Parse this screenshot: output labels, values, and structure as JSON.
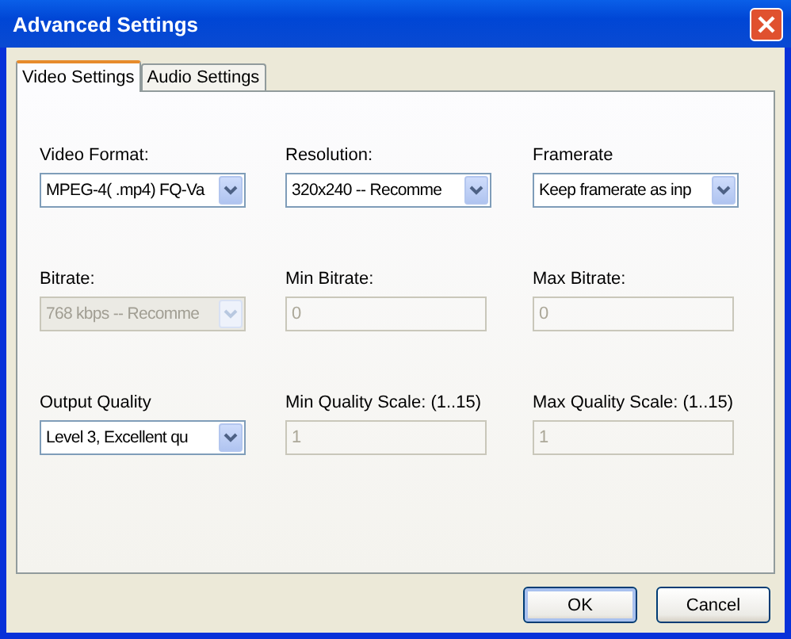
{
  "window": {
    "title": "Advanced Settings"
  },
  "tabs": [
    {
      "label": "Video Settings",
      "selected": true
    },
    {
      "label": "Audio Settings",
      "selected": false
    }
  ],
  "fields": [
    {
      "label": "Video Format:",
      "kind": "select",
      "value": "MPEG-4( .mp4) FQ-Va",
      "disabled": false
    },
    {
      "label": "Resolution:",
      "kind": "select",
      "value": "320x240 -- Recomme",
      "disabled": false
    },
    {
      "label": "Framerate",
      "kind": "select",
      "value": "Keep framerate as inp",
      "disabled": false
    },
    {
      "label": "Bitrate:",
      "kind": "select",
      "value": "768 kbps -- Recomme",
      "disabled": true
    },
    {
      "label": "Min Bitrate:",
      "kind": "text",
      "value": "0",
      "disabled": true
    },
    {
      "label": "Max Bitrate:",
      "kind": "text",
      "value": "0",
      "disabled": true
    },
    {
      "label": "Output Quality",
      "kind": "select",
      "value": "Level 3,  Excellent qu",
      "disabled": false
    },
    {
      "label": "Min Quality Scale: (1..15)",
      "kind": "text",
      "value": "1",
      "disabled": true
    },
    {
      "label": "Max Quality Scale: (1..15)",
      "kind": "text",
      "value": "1",
      "disabled": true
    }
  ],
  "buttons": [
    "OK",
    "Cancel"
  ]
}
